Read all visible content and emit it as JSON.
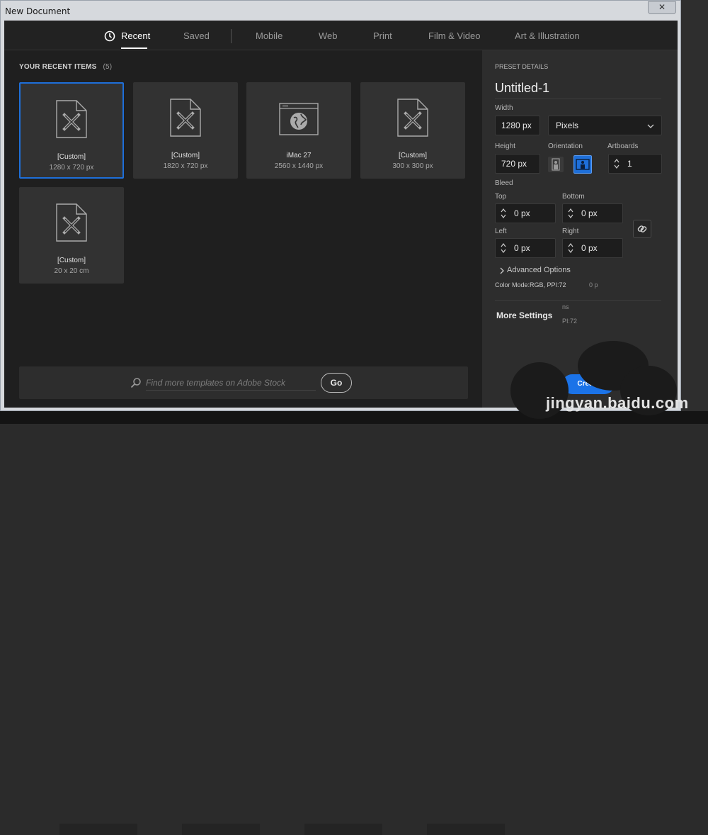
{
  "window": {
    "title": "New Document",
    "close_label": "✕"
  },
  "tabs": [
    {
      "label": "Recent",
      "active": true
    },
    {
      "label": "Saved"
    },
    {
      "label": "Mobile"
    },
    {
      "label": "Web"
    },
    {
      "label": "Print"
    },
    {
      "label": "Film & Video"
    },
    {
      "label": "Art & Illustration"
    }
  ],
  "recent": {
    "heading": "YOUR RECENT ITEMS",
    "count": "(5)",
    "items": [
      {
        "name": "[Custom]",
        "size": "1280 x 720 px",
        "icon": "custom-document-icon",
        "selected": true
      },
      {
        "name": "[Custom]",
        "size": "1820 x 720 px",
        "icon": "custom-document-icon"
      },
      {
        "name": "iMac 27",
        "size": "2560 x 1440 px",
        "icon": "web-browser-icon"
      },
      {
        "name": "[Custom]",
        "size": "300 x 300 px",
        "icon": "custom-document-icon"
      },
      {
        "name": "[Custom]",
        "size": "20 x 20 cm",
        "icon": "custom-document-icon"
      }
    ]
  },
  "search": {
    "placeholder": "Find more templates on Adobe Stock",
    "go_label": "Go"
  },
  "preset": {
    "heading": "PRESET DETAILS",
    "name": "Untitled-1",
    "width_label": "Width",
    "width_value": "1280 px",
    "units": "Pixels",
    "height_label": "Height",
    "height_value": "720 px",
    "orientation_label": "Orientation",
    "artboards_label": "Artboards",
    "artboards_value": "1",
    "bleed_label": "Bleed",
    "top_label": "Top",
    "top_value": "0 px",
    "bottom_label": "Bottom",
    "bottom_value": "0 px",
    "left_label": "Left",
    "left_value": "0 px",
    "right_label": "Right",
    "right_value": "0 px",
    "advanced_label": "Advanced Options",
    "color_mode": "Color Mode:RGB, PPI:72",
    "ghost_a": "0 p",
    "ghost_b": "ns",
    "ghost_c": "PI:72",
    "more_settings": "More Settings",
    "create_label": "Create"
  },
  "watermark": "jingyan.baidu.com",
  "colors": {
    "accent": "#1e6fd9",
    "panel": "#2d2d2d",
    "background": "#1f1f1f"
  }
}
